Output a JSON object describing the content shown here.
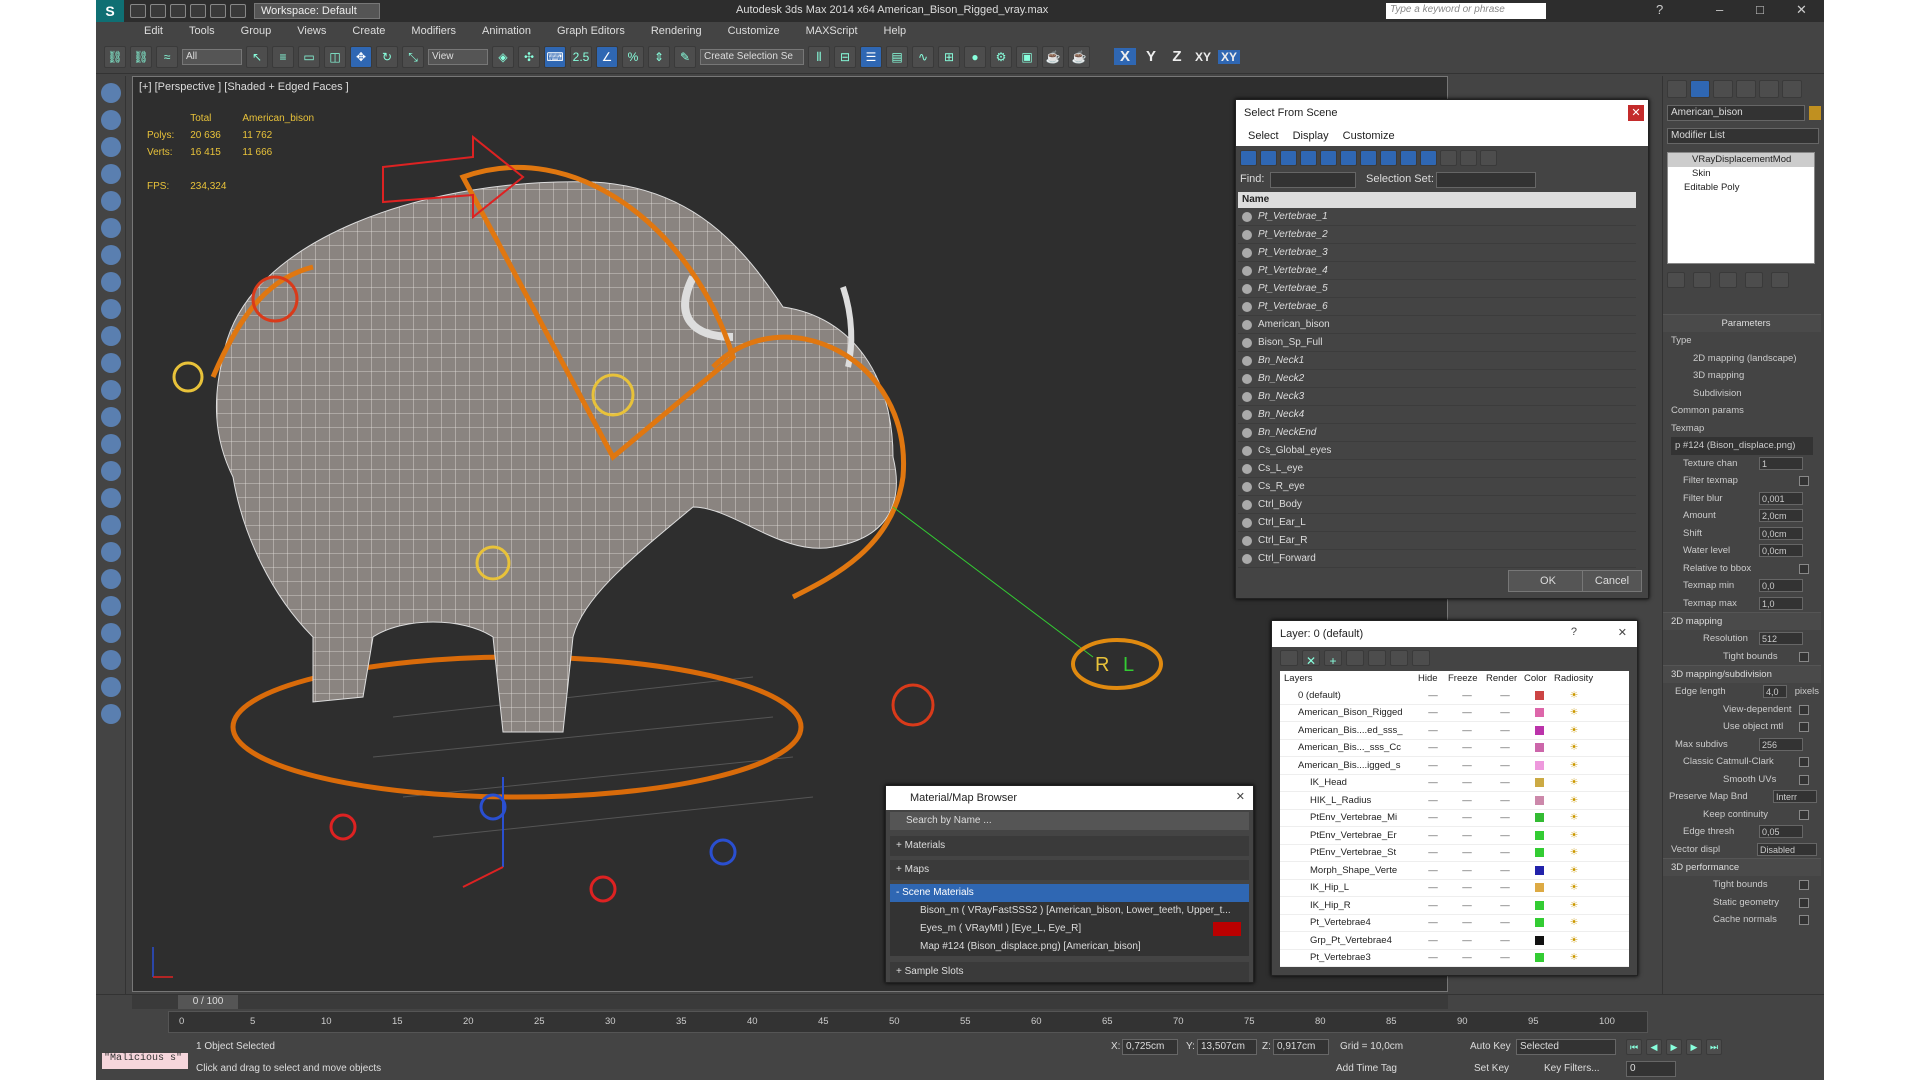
{
  "window": {
    "title": "Autodesk 3ds Max  2014 x64    American_Bison_Rigged_vray.max",
    "workspace": "Workspace: Default",
    "search_placeholder": "Type a keyword or phrase"
  },
  "menu": [
    "Edit",
    "Tools",
    "Group",
    "Views",
    "Create",
    "Modifiers",
    "Animation",
    "Graph Editors",
    "Rendering",
    "Customize",
    "MAXScript",
    "Help"
  ],
  "toolbar": {
    "filter": "All",
    "ref_coord": "View",
    "selection_set": "Create Selection Se",
    "angle": "2.5",
    "axes": [
      "X",
      "Y",
      "Z",
      "XY",
      "XY"
    ]
  },
  "viewport": {
    "label": "[+] [Perspective ] [Shaded + Edged Faces ]",
    "stats": {
      "col_total": "Total",
      "col_obj": "American_bison",
      "polys_label": "Polys:",
      "polys_total": "20 636",
      "polys_obj": "11 762",
      "verts_label": "Verts:",
      "verts_total": "16 415",
      "verts_obj": "11 666",
      "fps_label": "FPS:",
      "fps": "234,324"
    },
    "tag_r": "R",
    "tag_l": "L"
  },
  "select_dialog": {
    "title": "Select From Scene",
    "menu": [
      "Select",
      "Display",
      "Customize"
    ],
    "find_label": "Find:",
    "selset_label": "Selection Set:",
    "col_name": "Name",
    "items": [
      "Pt_Vertebrae_1",
      "Pt_Vertebrae_2",
      "Pt_Vertebrae_3",
      "Pt_Vertebrae_4",
      "Pt_Vertebrae_5",
      "Pt_Vertebrae_6",
      "American_bison",
      "Bison_Sp_Full",
      "Bn_Neck1",
      "Bn_Neck2",
      "Bn_Neck3",
      "Bn_Neck4",
      "Bn_NeckEnd",
      "Cs_Global_eyes",
      "Cs_L_eye",
      "Cs_R_eye",
      "Ctrl_Body",
      "Ctrl_Ear_L",
      "Ctrl_Ear_R",
      "Ctrl_Forward"
    ],
    "ok": "OK",
    "cancel": "Cancel"
  },
  "layer_dialog": {
    "title": "Layer: 0 (default)",
    "help": "?",
    "cols": [
      "Layers",
      "Hide",
      "Freeze",
      "Render",
      "Color",
      "Radiosity"
    ],
    "rows": [
      {
        "name": "0 (default)",
        "color": "#c44"
      },
      {
        "name": "American_Bison_Rigged",
        "color": "#d6a"
      },
      {
        "name": "American_Bis....ed_sss_",
        "color": "#b3a"
      },
      {
        "name": "American_Bis..._sss_Cc",
        "color": "#c6a"
      },
      {
        "name": "American_Bis....igged_s",
        "color": "#e9d"
      },
      {
        "name": "IK_Head",
        "color": "#ca4"
      },
      {
        "name": "HIK_L_Radius",
        "color": "#c8a"
      },
      {
        "name": "PtEnv_Vertebrae_Mi",
        "color": "#3b3"
      },
      {
        "name": "PtEnv_Vertebrae_Er",
        "color": "#3c3"
      },
      {
        "name": "PtEnv_Vertebrae_St",
        "color": "#3c3"
      },
      {
        "name": "Morph_Shape_Verte",
        "color": "#22a"
      },
      {
        "name": "IK_Hip_L",
        "color": "#da4"
      },
      {
        "name": "IK_Hip_R",
        "color": "#3c3"
      },
      {
        "name": "Pt_Vertebrae4",
        "color": "#3c3"
      },
      {
        "name": "Grp_Pt_Vertebrae4",
        "color": "#111"
      },
      {
        "name": "Pt_Vertebrae3",
        "color": "#3c3"
      }
    ]
  },
  "material_browser": {
    "title": "Material/Map Browser",
    "search": "Search by Name ...",
    "materials": "+ Materials",
    "maps": "+ Maps",
    "scene": "- Scene Materials",
    "items": [
      "Bison_m  ( VRayFastSSS2 )  [American_bison, Lower_teeth, Upper_t...",
      "Eyes_m  ( VRayMtl )  [Eye_L, Eye_R]",
      "Map #124 (Bison_displace.png) [American_bison]"
    ],
    "samples": "+ Sample Slots"
  },
  "command_panel": {
    "object_name": "American_bison",
    "modifier_list": "Modifier List",
    "stack": [
      "VRayDisplacementMod",
      "Skin",
      "Editable Poly"
    ],
    "params_title": "Parameters",
    "type_label": "Type",
    "type_opts": [
      "2D mapping (landscape)",
      "3D mapping",
      "Subdivision"
    ],
    "common": "Common params",
    "texmap": "Texmap",
    "texmap_val": "p #124 (Bison_displace.png)",
    "fields": [
      {
        "label": "Texture chan",
        "value": "1",
        "check": false
      },
      {
        "label": "Filter texmap",
        "value": "",
        "check": true
      },
      {
        "label": "Filter blur",
        "value": "0,001",
        "check": false
      },
      {
        "label": "Amount",
        "value": "2,0cm",
        "check": false
      },
      {
        "label": "Shift",
        "value": "0,0cm",
        "check": false
      },
      {
        "label": "Water level",
        "value": "0,0cm",
        "check": true
      },
      {
        "label": "Relative to bbox",
        "value": "",
        "check": true
      },
      {
        "label": "Texmap min",
        "value": "0,0",
        "check": false
      },
      {
        "label": "Texmap max",
        "value": "1,0",
        "check": false
      }
    ],
    "sec2d": "2D mapping",
    "res_label": "Resolution",
    "res_val": "512",
    "tight": "Tight bounds",
    "sec3d": "3D mapping/subdivision",
    "edge_len": "Edge length",
    "edge_val": "4,0",
    "pixels": "pixels",
    "view_dep": "View-dependent",
    "use_obj": "Use object mtl",
    "max_sub": "Max subdivs",
    "max_sub_val": "256",
    "classic": "Classic Catmull-Clark",
    "smooth": "Smooth UVs",
    "preserve": "Preserve Map Bnd",
    "preserve_val": "Interr",
    "keep": "Keep continuity",
    "edge_thr": "Edge thresh",
    "edge_thr_val": "0,05",
    "vector": "Vector displ",
    "vector_val": "Disabled",
    "perf": "3D performance",
    "tight2": "Tight bounds",
    "static": "Static geometry",
    "cache": "Cache normals"
  },
  "bottom": {
    "frame": "0 / 100",
    "ticks": [
      "0",
      "5",
      "10",
      "15",
      "20",
      "25",
      "30",
      "35",
      "40",
      "45",
      "50",
      "55",
      "60",
      "65",
      "70",
      "75",
      "80",
      "85",
      "90",
      "95",
      "100"
    ],
    "script": "\"Malicious s\"",
    "selected": "1 Object Selected",
    "hint": "Click and drag to select and move objects",
    "x_label": "X:",
    "x": "0,725cm",
    "y_label": "Y:",
    "y": "13,507cm",
    "z_label": "Z:",
    "z": "0,917cm",
    "grid": "Grid = 10,0cm",
    "autokey": "Auto Key",
    "setkey": "Set Key",
    "selected_dd": "Selected",
    "keyfilters": "Key Filters...",
    "addtag": "Add Time Tag",
    "frame_val": "0"
  }
}
